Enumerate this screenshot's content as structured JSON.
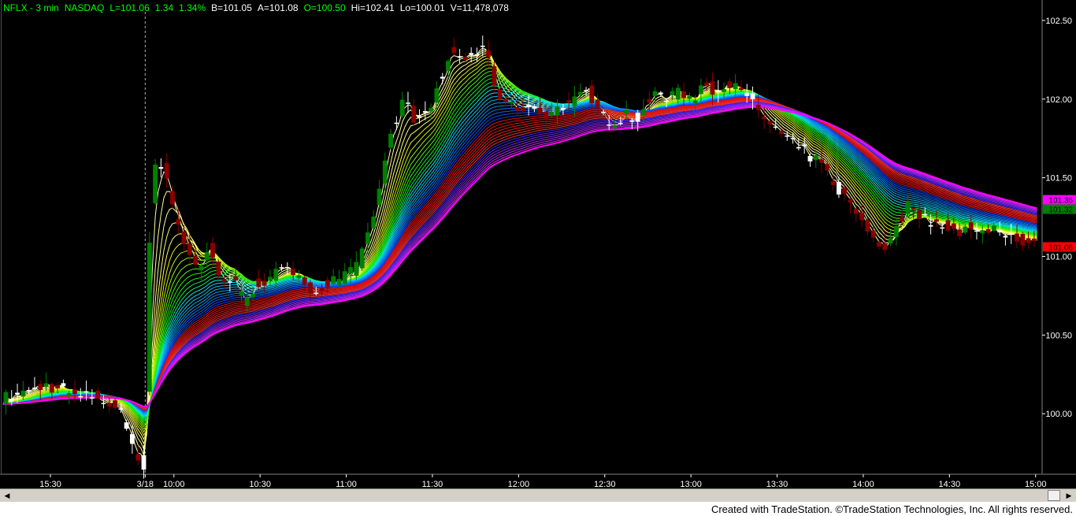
{
  "header": {
    "symbol": "NFLX - 3 min",
    "exchange": "NASDAQ",
    "last": "L=101.06",
    "change": "1.34",
    "change_pct": "1.34%",
    "bid": "B=101.05",
    "ask": "A=101.08",
    "open": "O=100.50",
    "high": "Hi=102.41",
    "low": "Lo=100.01",
    "volume": "V=11,478,078"
  },
  "price_tags": [
    {
      "label": "101.36",
      "value": 101.36,
      "color": "#ff00ff",
      "text_color": "#000000"
    },
    {
      "label": "101.32",
      "value": 101.3,
      "color": "#008000",
      "text_color": "#000000"
    },
    {
      "label": "101.06",
      "value": 101.06,
      "color": "#ff0000",
      "text_color": "#000000"
    }
  ],
  "footer": {
    "text": "Created with TradeStation. ©TradeStation Technologies, Inc. All rights reserved."
  },
  "colors": {
    "up": "#008000",
    "down": "#8b0000",
    "doji": "#ffffff",
    "ribbon_fast": "#ffffc8",
    "ribbon_slow": "#ff00ff",
    "axis_text": "#ffffff",
    "separator": "#808080"
  },
  "chart_data": {
    "type": "candlestick",
    "y_ticks": [
      "102.50",
      "102.00",
      "101.50",
      "101.00",
      "100.50",
      "100.00"
    ],
    "y_tick_values": [
      102.5,
      102.0,
      101.5,
      101.0,
      100.5,
      100.0
    ],
    "ylim": [
      99.62,
      102.62
    ],
    "x_ticks": [
      "15:30",
      "3/18",
      "10:00",
      "10:30",
      "11:00",
      "11:30",
      "12:00",
      "12:30",
      "13:00",
      "13:30",
      "14:00",
      "14:30",
      "15:00"
    ],
    "x_tick_bars": [
      17,
      50,
      60,
      90,
      120,
      150,
      180,
      210,
      240,
      270,
      300,
      330,
      360
    ],
    "session_break_bar": 50,
    "total_slots": 362,
    "anchors": [
      [
        0,
        100.1
      ],
      [
        8,
        100.13
      ],
      [
        14,
        100.18
      ],
      [
        20,
        100.16
      ],
      [
        26,
        100.1
      ],
      [
        32,
        100.12
      ],
      [
        38,
        100.05
      ],
      [
        42,
        99.98
      ],
      [
        46,
        99.75
      ],
      [
        49,
        99.68
      ],
      [
        50,
        100.15
      ],
      [
        51,
        101.1
      ],
      [
        53,
        101.55
      ],
      [
        56,
        101.6
      ],
      [
        60,
        101.25
      ],
      [
        64,
        101.05
      ],
      [
        68,
        100.9
      ],
      [
        72,
        101.05
      ],
      [
        76,
        100.85
      ],
      [
        80,
        100.85
      ],
      [
        84,
        100.72
      ],
      [
        88,
        100.82
      ],
      [
        92,
        100.85
      ],
      [
        96,
        100.9
      ],
      [
        100,
        100.9
      ],
      [
        104,
        100.9
      ],
      [
        108,
        100.75
      ],
      [
        112,
        100.82
      ],
      [
        116,
        100.85
      ],
      [
        120,
        100.88
      ],
      [
        124,
        100.95
      ],
      [
        128,
        101.2
      ],
      [
        132,
        101.5
      ],
      [
        136,
        101.85
      ],
      [
        140,
        102.0
      ],
      [
        144,
        101.85
      ],
      [
        148,
        101.9
      ],
      [
        152,
        102.1
      ],
      [
        156,
        102.3
      ],
      [
        160,
        102.25
      ],
      [
        164,
        102.3
      ],
      [
        168,
        102.3
      ],
      [
        172,
        102.05
      ],
      [
        176,
        101.95
      ],
      [
        180,
        101.95
      ],
      [
        184,
        101.95
      ],
      [
        188,
        101.9
      ],
      [
        192,
        101.92
      ],
      [
        196,
        101.98
      ],
      [
        200,
        102.0
      ],
      [
        204,
        102.05
      ],
      [
        208,
        101.9
      ],
      [
        212,
        101.85
      ],
      [
        216,
        101.9
      ],
      [
        220,
        101.88
      ],
      [
        224,
        101.96
      ],
      [
        228,
        102.05
      ],
      [
        232,
        102.0
      ],
      [
        236,
        102.05
      ],
      [
        240,
        102.0
      ],
      [
        244,
        102.1
      ],
      [
        248,
        102.05
      ],
      [
        252,
        102.12
      ],
      [
        256,
        102.05
      ],
      [
        260,
        102.0
      ],
      [
        264,
        101.9
      ],
      [
        268,
        101.82
      ],
      [
        272,
        101.75
      ],
      [
        276,
        101.7
      ],
      [
        280,
        101.65
      ],
      [
        284,
        101.6
      ],
      [
        288,
        101.5
      ],
      [
        292,
        101.4
      ],
      [
        296,
        101.3
      ],
      [
        300,
        101.2
      ],
      [
        304,
        101.1
      ],
      [
        308,
        101.05
      ],
      [
        312,
        101.22
      ],
      [
        316,
        101.35
      ],
      [
        320,
        101.25
      ],
      [
        324,
        101.2
      ],
      [
        328,
        101.22
      ],
      [
        332,
        101.15
      ],
      [
        336,
        101.18
      ],
      [
        340,
        101.13
      ],
      [
        344,
        101.2
      ],
      [
        348,
        101.15
      ],
      [
        352,
        101.12
      ],
      [
        356,
        101.1
      ],
      [
        360,
        101.08
      ]
    ]
  }
}
